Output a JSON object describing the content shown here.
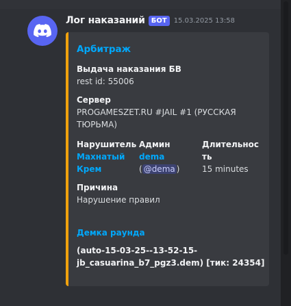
{
  "message": {
    "avatar_icon": "discord-logo-icon",
    "avatar_color": "#5865f2",
    "author": "Лог наказаний",
    "bot_badge": "БОТ",
    "timestamp": "15.03.2025 13:58"
  },
  "embed": {
    "accent_color": "#f0a20e",
    "title": "Арбитраж",
    "punishment": {
      "name": "Выдача наказания БВ",
      "value": "rest id: 55006"
    },
    "server": {
      "name": "Сервер",
      "value": "PROGAMESZET.RU #JAIL #1 (РУССКАЯ ТЮРЬМА)"
    },
    "violator": {
      "name": "Нарушитель",
      "value_line1": "Махнатый",
      "value_line2": "Крем"
    },
    "admin": {
      "name": "Админ",
      "value": "dema",
      "mention_open": "(",
      "mention": "@dema",
      "mention_close": ")"
    },
    "duration": {
      "name_line1": "Длительнос",
      "name_line2": "ть",
      "value": "15 minutes"
    },
    "reason": {
      "name": "Причина",
      "value": "Нарушение правил"
    },
    "demo": {
      "title": "Демка раунда",
      "value": "(auto-15-03-25--13-52-15-jb_casuarina_b7_pgz3.dem) [тик: 24354]"
    }
  }
}
